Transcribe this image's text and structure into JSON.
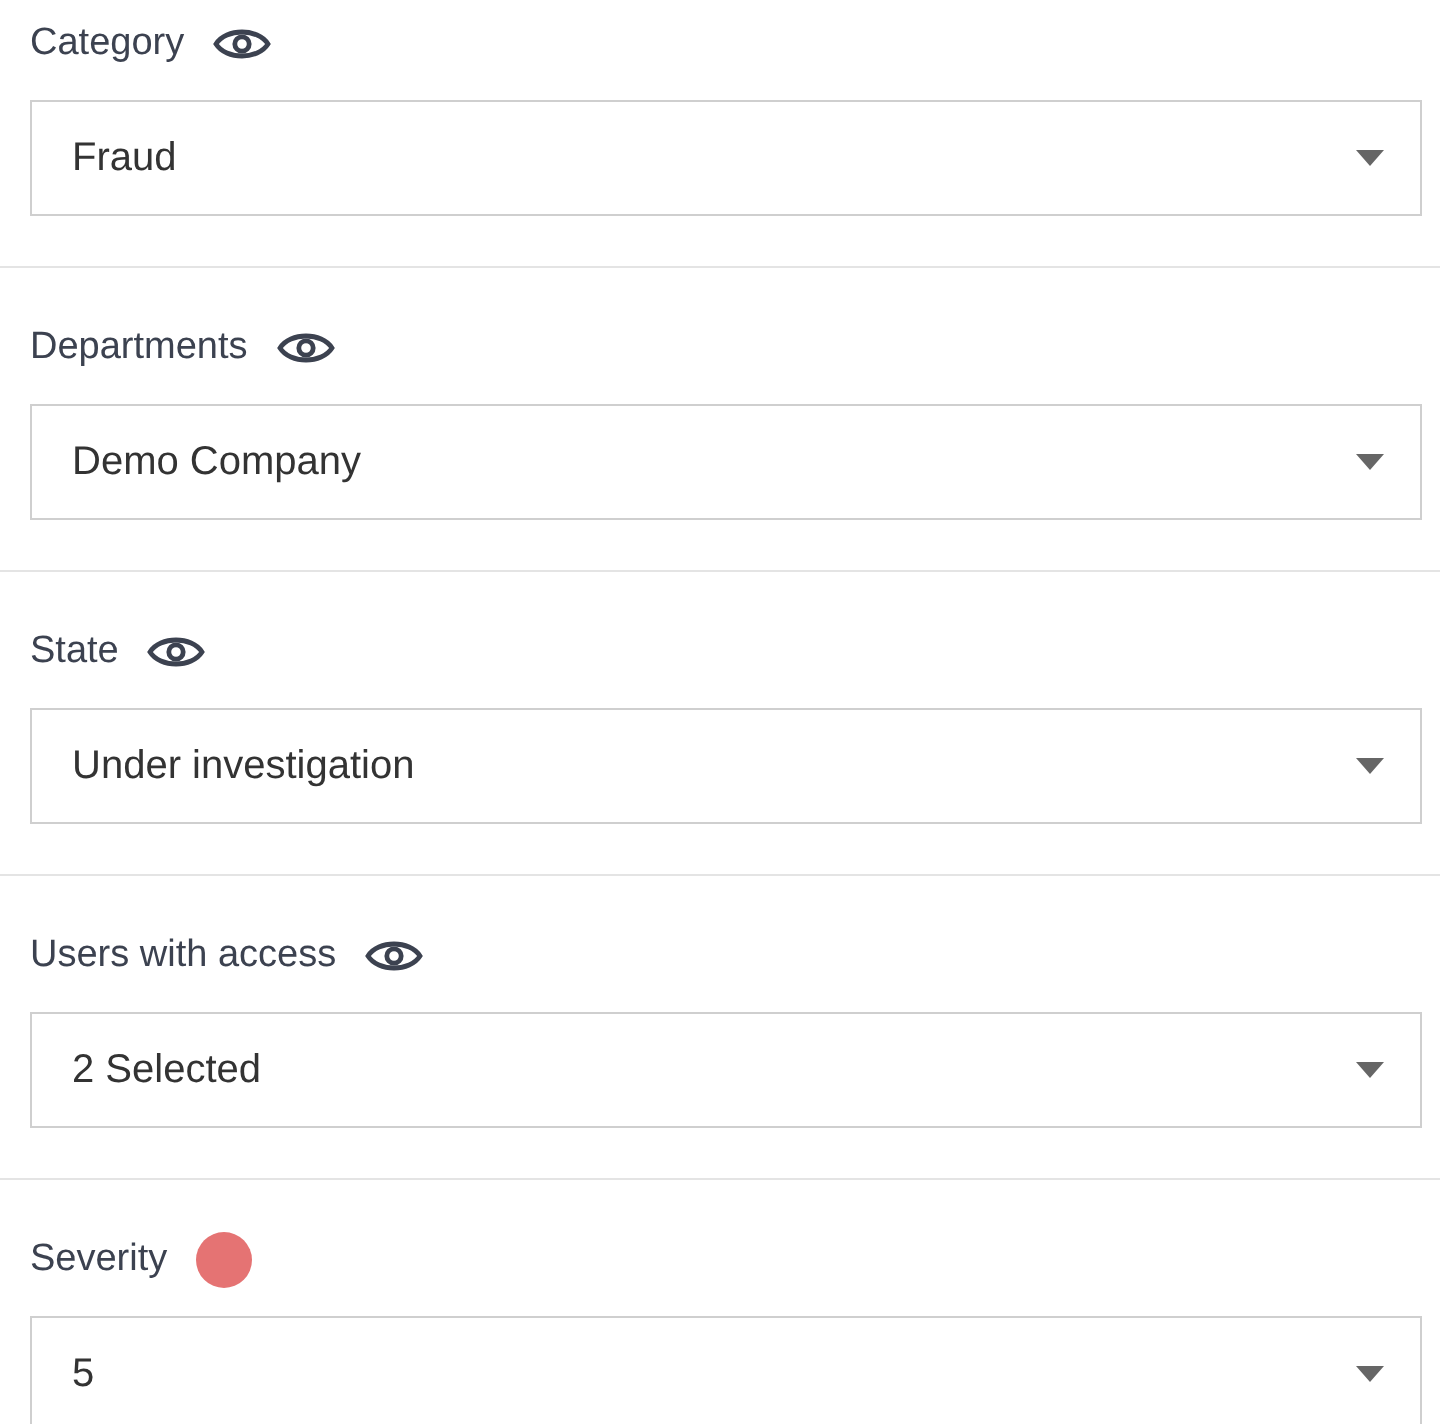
{
  "fields": [
    {
      "label": "Category",
      "kind": "visibility",
      "value": "Fraud"
    },
    {
      "label": "Departments",
      "kind": "visibility",
      "value": "Demo Company"
    },
    {
      "label": "State",
      "kind": "visibility",
      "value": "Under investigation"
    },
    {
      "label": "Users with access",
      "kind": "visibility",
      "value": "2 Selected"
    },
    {
      "label": "Severity",
      "kind": "color",
      "color": "#e57373",
      "value": "5"
    }
  ]
}
